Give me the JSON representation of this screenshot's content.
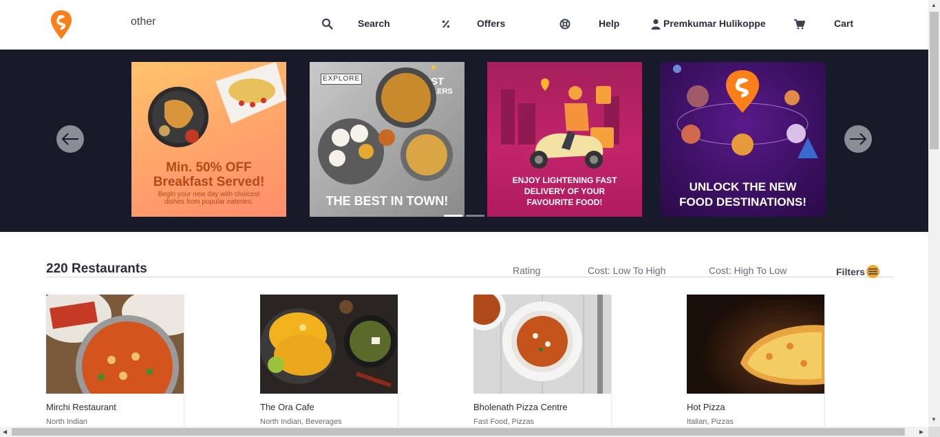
{
  "header": {
    "location": "other",
    "nav": {
      "search": "Search",
      "offers": "Offers",
      "help": "Help",
      "user": "Premkumar Hulikoppe",
      "cart": "Cart"
    }
  },
  "carousel": {
    "slides": [
      {
        "headline": "Min. 50% OFF",
        "headline2": "Breakfast Served!",
        "sub": "Begin your new day with choicest",
        "sub2": "dishes from popular eateries."
      },
      {
        "badge": "EXPLORE",
        "tag1": "BEST",
        "tag2": "SELLERS",
        "headline": "THE BEST IN TOWN!"
      },
      {
        "line1": "ENJOY LIGHTENING FAST",
        "line2": "DELIVERY OF YOUR",
        "line3": "FAVOURITE FOOD!"
      },
      {
        "line1": "UNLOCK THE NEW",
        "line2": "FOOD DESTINATIONS!"
      }
    ]
  },
  "restaurants": {
    "count_label": "220 Restaurants",
    "sort": [
      "Rating",
      "Cost: Low To High",
      "Cost: High To Low"
    ],
    "filters_label": "Filters",
    "cards": [
      {
        "name": "Mirchi Restaurant",
        "cuisine": "North Indian"
      },
      {
        "name": "The Ora Cafe",
        "cuisine": "North Indian, Beverages"
      },
      {
        "name": "Bholenath Pizza Centre",
        "cuisine": "Fast Food, Pizzas"
      },
      {
        "name": "Hot Pizza",
        "cuisine": "Italian, Pizzas"
      }
    ]
  },
  "colors": {
    "brand": "#fc8019",
    "carousel_bg": "#171a29",
    "text_dark": "#282c3f",
    "text_muted": "#686b78"
  }
}
